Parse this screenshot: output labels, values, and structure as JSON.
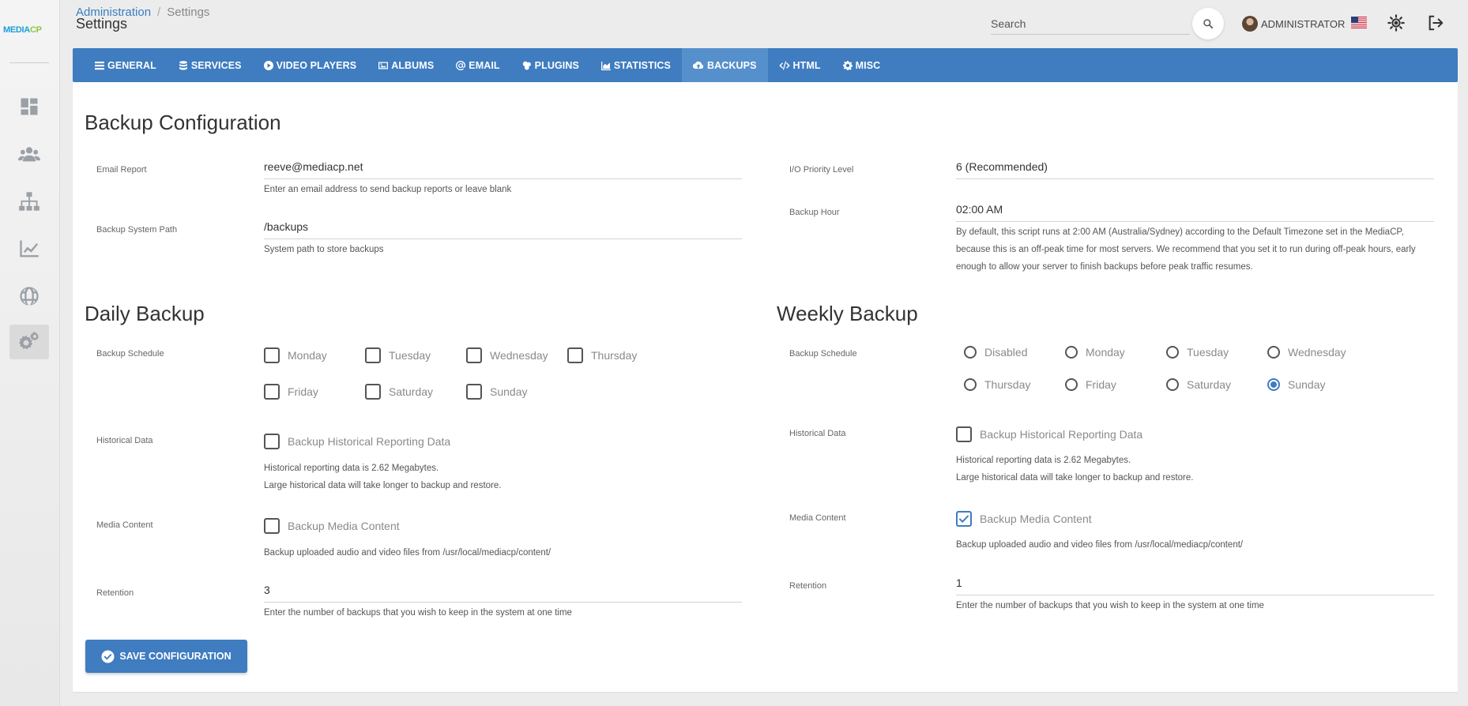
{
  "app": {
    "logo_part1": "MEDIA",
    "logo_part2": "CP"
  },
  "header": {
    "breadcrumb_root": "Administration",
    "breadcrumb_sep": "/",
    "breadcrumb_current": "Settings",
    "title": "Settings",
    "search_placeholder": "Search",
    "user_name": "ADMINISTRATOR"
  },
  "sidebar": {
    "items": [
      {
        "icon": "dashboard-icon"
      },
      {
        "icon": "users-icon"
      },
      {
        "icon": "sitemap-icon"
      },
      {
        "icon": "chart-line-icon"
      },
      {
        "icon": "globe-icon"
      },
      {
        "icon": "cogs-icon",
        "active": true
      }
    ]
  },
  "tabs": [
    {
      "label": "GENERAL",
      "icon": "list-icon"
    },
    {
      "label": "SERVICES",
      "icon": "database-icon"
    },
    {
      "label": "VIDEO PLAYERS",
      "icon": "play-circle-icon"
    },
    {
      "label": "ALBUMS",
      "icon": "image-icon"
    },
    {
      "label": "EMAIL",
      "icon": "at-icon"
    },
    {
      "label": "PLUGINS",
      "icon": "puzzle-icon"
    },
    {
      "label": "STATISTICS",
      "icon": "chart-area-icon"
    },
    {
      "label": "BACKUPS",
      "icon": "cloud-upload-icon",
      "active": true
    },
    {
      "label": "HTML",
      "icon": "code-icon"
    },
    {
      "label": "MISC",
      "icon": "cog-icon"
    }
  ],
  "config": {
    "heading": "Backup Configuration",
    "email_label": "Email Report",
    "email_value": "reeve@mediacp.net",
    "email_help": "Enter an email address to send backup reports or leave blank",
    "path_label": "Backup System Path",
    "path_value": "/backups",
    "path_help": "System path to store backups",
    "io_label": "I/O Priority Level",
    "io_value": "6 (Recommended)",
    "hour_label": "Backup Hour",
    "hour_value": "02:00 AM",
    "hour_help_1": "By default, this script runs at 2:00 AM (Australia/Sydney) according to the Default Timezone set in the MediaCP,",
    "hour_help_2": "because this is an off-peak time for most servers. We recommend that you set it to run during off-peak hours, early",
    "hour_help_3": "enough to allow your server to finish backups before peak traffic resumes."
  },
  "daily": {
    "heading": "Daily Backup",
    "schedule_label": "Backup Schedule",
    "days": [
      {
        "label": "Monday",
        "checked": false
      },
      {
        "label": "Tuesday",
        "checked": false
      },
      {
        "label": "Wednesday",
        "checked": false
      },
      {
        "label": "Thursday",
        "checked": false
      },
      {
        "label": "Friday",
        "checked": false
      },
      {
        "label": "Saturday",
        "checked": false
      },
      {
        "label": "Sunday",
        "checked": false
      }
    ],
    "historical_label": "Historical Data",
    "historical_option": "Backup Historical Reporting Data",
    "historical_checked": false,
    "historical_help_1": "Historical reporting data is 2.62 Megabytes.",
    "historical_help_2": "Large historical data will take longer to backup and restore.",
    "media_label": "Media Content",
    "media_option": "Backup Media Content",
    "media_checked": false,
    "media_help": "Backup uploaded audio and video files from /usr/local/mediacp/content/",
    "retention_label": "Retention",
    "retention_value": "3",
    "retention_help": "Enter the number of backups that you wish to keep in the system at one time"
  },
  "weekly": {
    "heading": "Weekly Backup",
    "schedule_label": "Backup Schedule",
    "days": [
      {
        "label": "Disabled",
        "checked": false
      },
      {
        "label": "Monday",
        "checked": false
      },
      {
        "label": "Tuesday",
        "checked": false
      },
      {
        "label": "Wednesday",
        "checked": false
      },
      {
        "label": "Thursday",
        "checked": false
      },
      {
        "label": "Friday",
        "checked": false
      },
      {
        "label": "Saturday",
        "checked": false
      },
      {
        "label": "Sunday",
        "checked": true
      }
    ],
    "historical_label": "Historical Data",
    "historical_option": "Backup Historical Reporting Data",
    "historical_checked": false,
    "historical_help_1": "Historical reporting data is 2.62 Megabytes.",
    "historical_help_2": "Large historical data will take longer to backup and restore.",
    "media_label": "Media Content",
    "media_option": "Backup Media Content",
    "media_checked": true,
    "media_help": "Backup uploaded audio and video files from /usr/local/mediacp/content/",
    "retention_label": "Retention",
    "retention_value": "1",
    "retention_help": "Enter the number of backups that you wish to keep in the system at one time"
  },
  "actions": {
    "save_label": "SAVE CONFIGURATION"
  },
  "colors": {
    "accent": "#3f7cc0",
    "tab_active": "#5690cc",
    "logo_blue": "#1b9fd8",
    "logo_green": "#8cc63f"
  }
}
